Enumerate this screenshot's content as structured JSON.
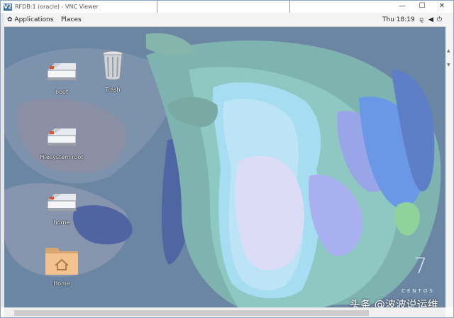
{
  "window": {
    "app_badge": "V2",
    "title": "RFDB:1 (oracle) - VNC Viewer",
    "controls": {
      "minimize": "—",
      "maximize": "☐",
      "close": "✕"
    }
  },
  "topbar": {
    "applications": "Applications",
    "places": "Places",
    "clock": "Thu 18:19",
    "status_icons": [
      "network-icon",
      "volume-icon",
      "power-icon"
    ]
  },
  "desktop": {
    "icons": [
      {
        "label": "boot",
        "type": "drive-icon"
      },
      {
        "label": "Trash",
        "type": "trash-icon"
      },
      {
        "label": "Filesystem root",
        "type": "drive-icon"
      },
      {
        "label": "home",
        "type": "drive-icon"
      },
      {
        "label": "Home",
        "type": "folder-home-icon"
      }
    ],
    "brand_numeral": "7",
    "brand_text": "CENTOS"
  },
  "watermark": "头条 @波波说运维",
  "colors": {
    "desktop_base": "#6e8aa4",
    "panel_bg": "#f3f3f3",
    "folder": "#f2c28f"
  }
}
